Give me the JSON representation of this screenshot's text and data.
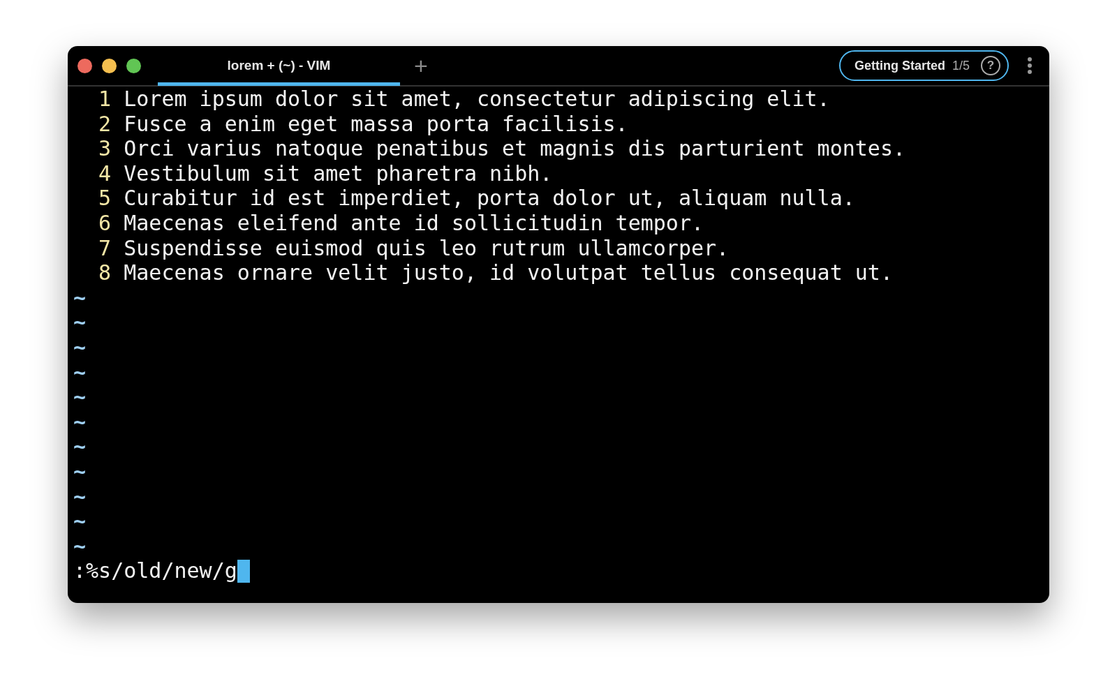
{
  "tabs": [
    {
      "label": "lorem + (~) - VIM",
      "selected": true
    }
  ],
  "new_tab": "+",
  "guide": {
    "label": "Getting Started",
    "progress": "1/5",
    "help": "?"
  },
  "lines": [
    {
      "number": "1",
      "text": "Lorem ipsum dolor sit amet, consectetur adipiscing elit."
    },
    {
      "number": "2",
      "text": "Fusce a enim eget massa porta facilisis."
    },
    {
      "number": "3",
      "text": "Orci varius natoque penatibus et magnis dis parturient montes."
    },
    {
      "number": "4",
      "text": "Vestibulum sit amet pharetra nibh."
    },
    {
      "number": "5",
      "text": "Curabitur id est imperdiet, porta dolor ut, aliquam nulla."
    },
    {
      "number": "6",
      "text": "Maecenas eleifend ante id sollicitudin tempor."
    },
    {
      "number": "7",
      "text": "Suspendisse euismod quis leo rutrum ullamcorper."
    },
    {
      "number": "8",
      "text": "Maecenas ornare velit justo, id volutpat tellus consequat ut."
    }
  ],
  "empty_lines": [
    "~",
    "~",
    "~",
    "~",
    "~",
    "~",
    "~",
    "~",
    "~",
    "~",
    "~"
  ],
  "command": {
    "text": ":%s/old/new/g"
  }
}
